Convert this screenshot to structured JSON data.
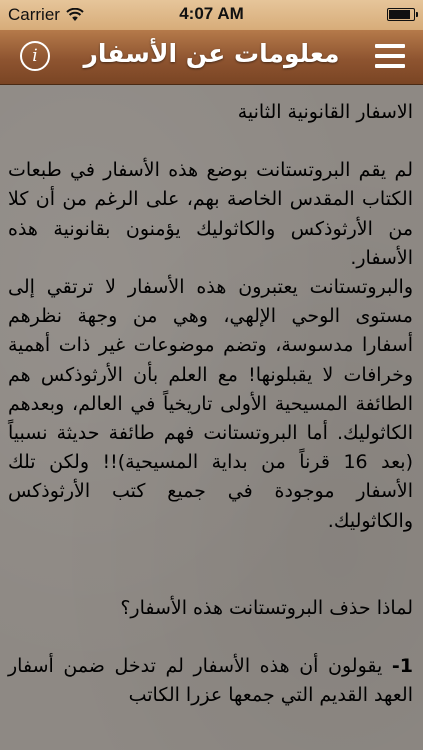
{
  "status_bar": {
    "carrier": "Carrier",
    "time": "4:07 AM",
    "battery_level": 0.95
  },
  "nav_bar": {
    "title": "معلومات عن الأسفار",
    "info_icon": "info-icon",
    "menu_icon": "hamburger-menu-icon",
    "info_glyph": "i"
  },
  "article": {
    "heading": "الاسفار القانونية الثانية",
    "paragraph_1": "لم يقم البروتستانت بوضع هذه الأسفار في طبعات الكتاب المقدس الخاصة بهم، على الرغم من أن كلا من الأرثوذكس والكاثوليك يؤمنون بقانونية هذه الأسفار.",
    "paragraph_2": "والبروتستانت يعتبرون هذه الأسفار لا ترتقي إلى مستوى الوحي الإلهي، وهي من وجهة نظرهم أسفارا مدسوسة، وتضم موضوعات غير ذات أهمية وخرافات لا يقبلونها!  مع العلم بأن الأرثوذكس هم الطائفة المسيحية الأولى تاريخياً في العالم، وبعدهم الكاثوليك.  أما البروتستانت فهم طائفة حديثة نسبياً (بعد 16 قرناً من بداية المسيحية)!!  ولكن تلك الأسفار موجودة في جميع كتب الأرثوذكس والكاثوليك.",
    "question": "لماذا حذف البروتستانت هذه الأسفار؟",
    "point_1_number": "1-",
    "point_1": "يقولون أن هذه الأسفار لم تدخل ضمن أسفار العهد القديم التي جمعها عزرا الكاتب"
  },
  "colors": {
    "nav_top": "#b57a4a",
    "nav_bottom": "#7a4524",
    "status_bar": "#dcb383",
    "content_background": "#8e8984"
  }
}
